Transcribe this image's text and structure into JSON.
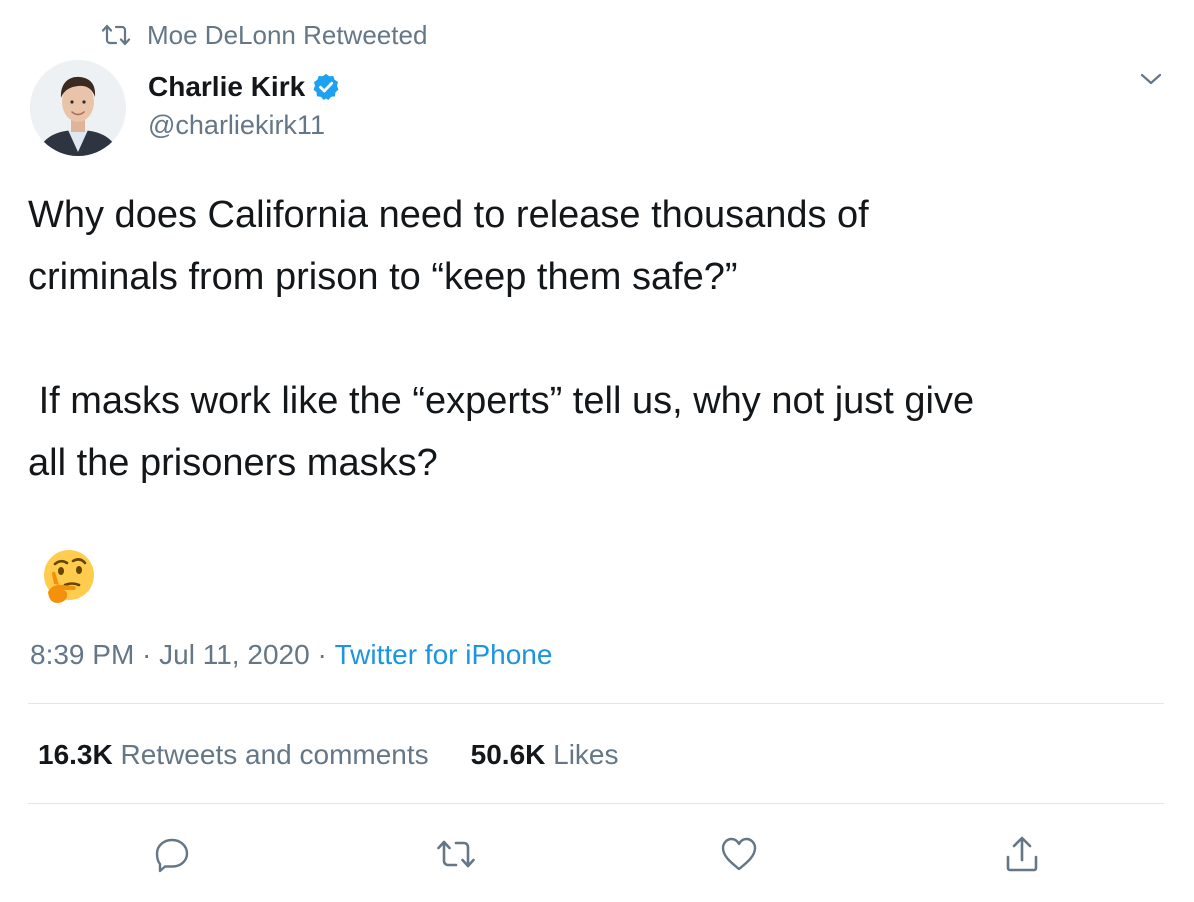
{
  "retweet_context": {
    "icon": "retweet-icon",
    "text": "Moe DeLonn Retweeted"
  },
  "author": {
    "display_name": "Charlie Kirk",
    "handle": "@charliekirk11",
    "verified_icon": "verified-badge-icon",
    "avatar": "avatar"
  },
  "tweet": {
    "text": "Why does California need to release thousands of\ncriminals from prison to “keep them safe?”\n\n If masks work like the “experts” tell us, why not just give\nall the prisoners masks?",
    "emoji": "🤔"
  },
  "meta": {
    "time": "8:39 PM",
    "separator": " · ",
    "date": "Jul 11, 2020",
    "source": "Twitter for iPhone"
  },
  "stats": {
    "retweets_count": "16.3K",
    "retweets_label": "Retweets and comments",
    "likes_count": "50.6K",
    "likes_label": "Likes"
  },
  "actions": [
    "reply-icon",
    "retweet-icon",
    "like-icon",
    "share-icon"
  ],
  "colors": {
    "text": "#14171a",
    "secondary": "#657786",
    "link": "#1b95e0",
    "verified": "#1da1f2",
    "divider": "#e1e8ed"
  }
}
